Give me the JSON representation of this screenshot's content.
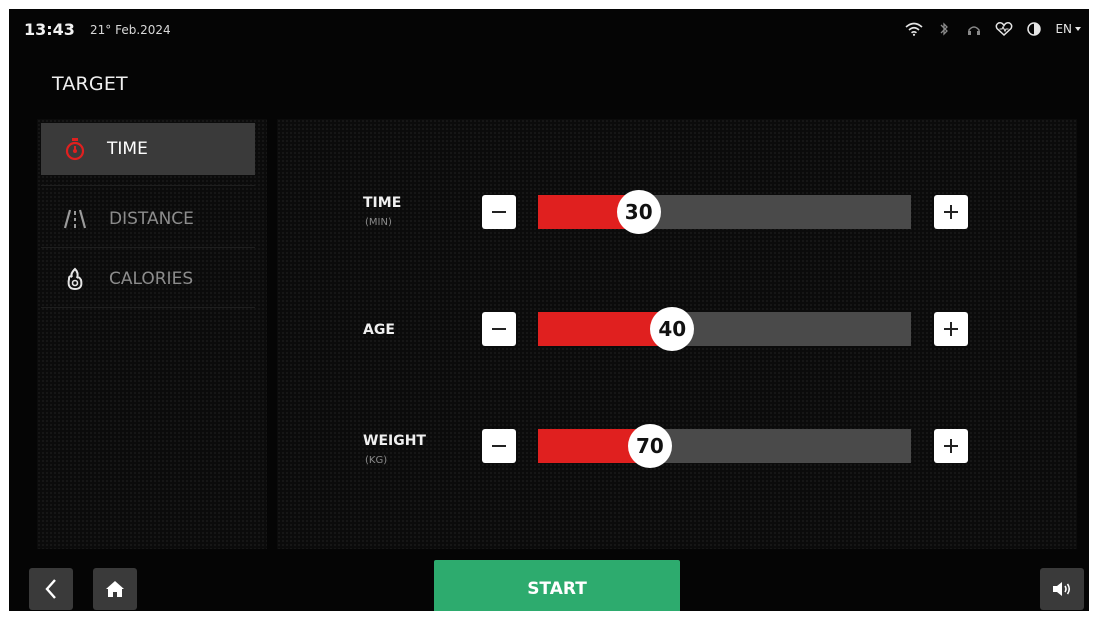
{
  "status": {
    "time": "13:43",
    "date": "21° Feb.2024",
    "language": "EN",
    "icons": [
      "wifi-icon",
      "bluetooth-icon",
      "headphones-icon",
      "heart-rate-icon",
      "contrast-icon"
    ]
  },
  "page": {
    "title": "TARGET"
  },
  "menu": {
    "items": [
      {
        "label": "TIME",
        "icon": "stopwatch-icon",
        "active": true
      },
      {
        "label": "DISTANCE",
        "icon": "road-icon",
        "active": false
      },
      {
        "label": "CALORIES",
        "icon": "flame-icon",
        "active": false
      }
    ]
  },
  "controls": [
    {
      "label": "TIME",
      "unit": "(MIN)",
      "value": "30",
      "fill_percent": 27
    },
    {
      "label": "AGE",
      "unit": "",
      "value": "40",
      "fill_percent": 36
    },
    {
      "label": "WEIGHT",
      "unit": "(KG)",
      "value": "70",
      "fill_percent": 30
    }
  ],
  "bottom": {
    "start_label": "START",
    "back_icon": "back-arrow-icon",
    "home_icon": "home-icon",
    "volume_icon": "volume-icon"
  },
  "colors": {
    "accent_red": "#e0201f",
    "start_green": "#2dab6e",
    "background": "#050505"
  }
}
